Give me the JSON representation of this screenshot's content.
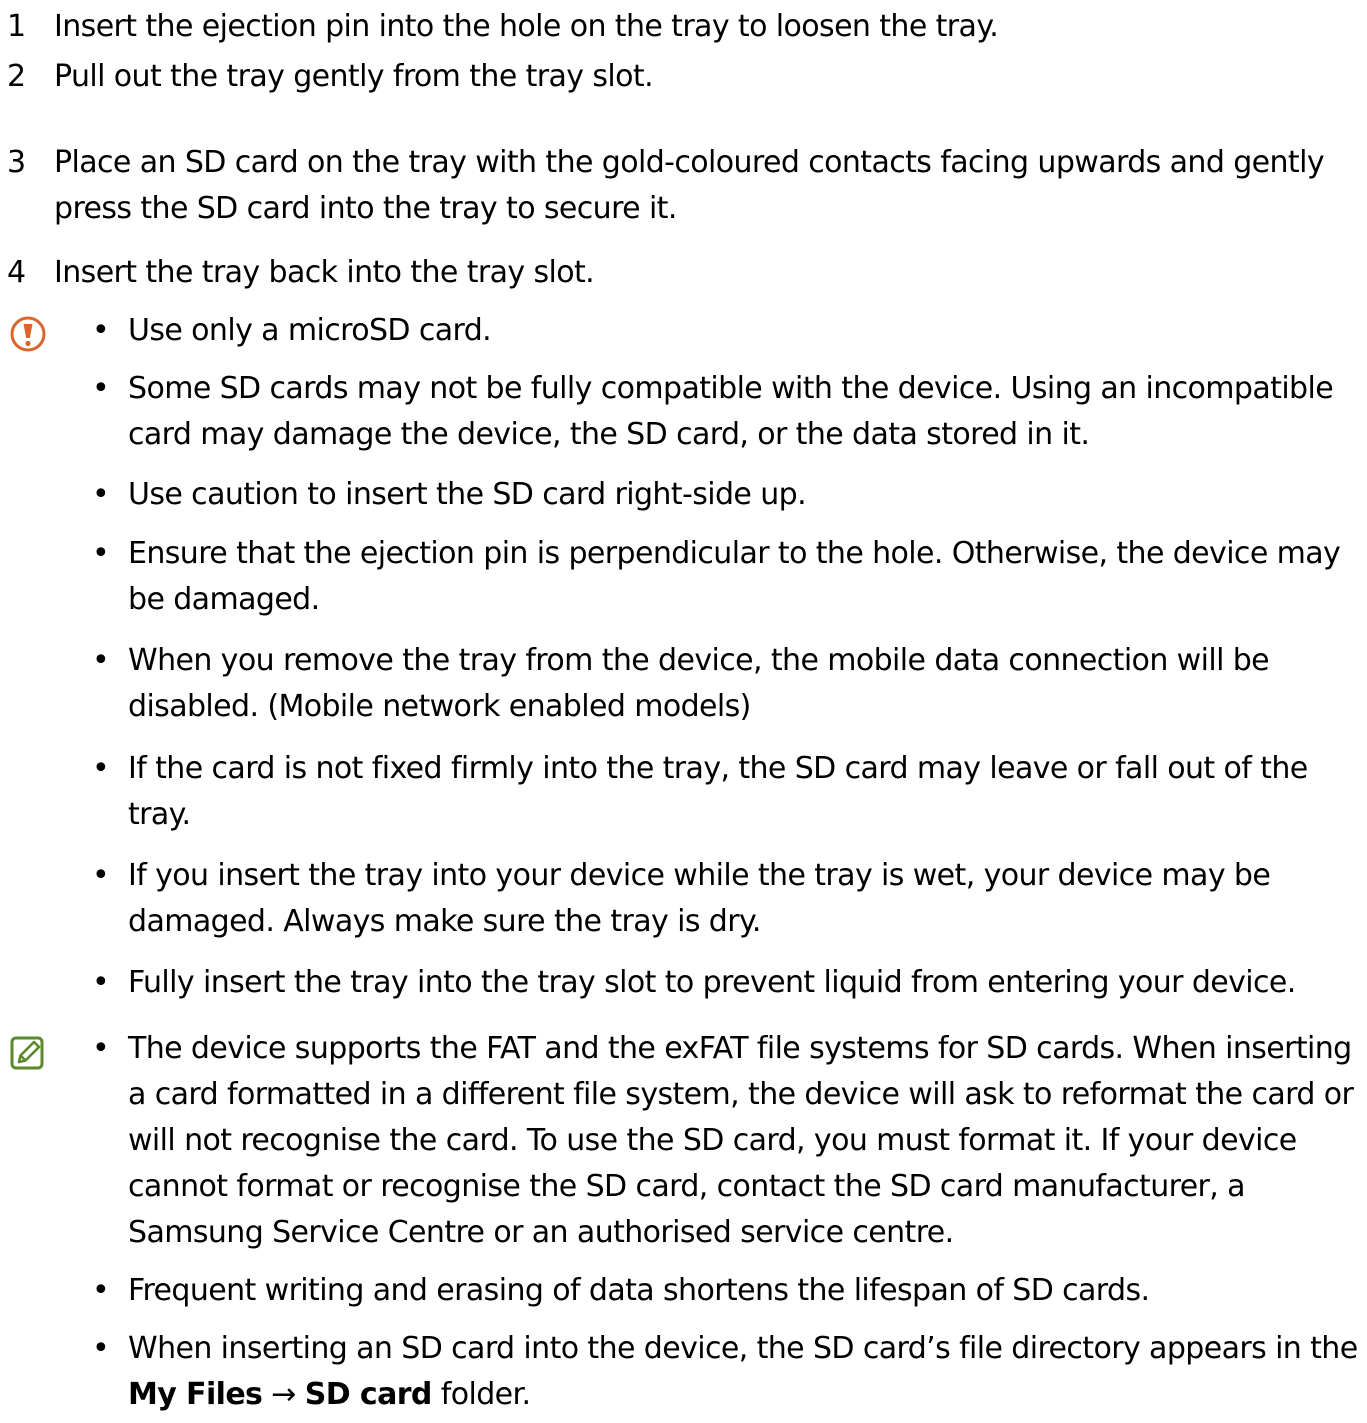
{
  "steps": [
    {
      "num": "1",
      "text": "Insert the ejection pin into the hole on the tray to loosen the tray."
    },
    {
      "num": "2",
      "text": "Pull out the tray gently from the tray slot."
    },
    {
      "num": "3",
      "text": "Place an SD card on the tray with the gold-coloured contacts facing upwards and gently press the SD card into the tray to secure it."
    },
    {
      "num": "4",
      "text": "Insert the tray back into the tray slot."
    }
  ],
  "caution": {
    "icon": "caution-exclamation-icon",
    "icon_color": "#d9642c",
    "bullet": "•",
    "items": [
      "Use only a microSD card.",
      "Some SD cards may not be fully compatible with the device. Using an incompatible card may damage the device, the SD card, or the data stored in it.",
      "Use caution to insert the SD card right-side up.",
      "Ensure that the ejection pin is perpendicular to the hole. Otherwise, the device may be damaged.",
      "When you remove the tray from the device, the mobile data connection will be disabled. (Mobile network enabled models)",
      "If the card is not fixed firmly into the tray, the SD card may leave or fall out of the tray.",
      "If you insert the tray into your device while the tray is wet, your device may be damaged. Always make sure the tray is dry.",
      "Fully insert the tray into the tray slot to prevent liquid from entering your device."
    ]
  },
  "note": {
    "icon": "note-pencil-icon",
    "icon_color": "#5a8a2b",
    "bullet": "•",
    "items": [
      "The device supports the FAT and the exFAT file systems for SD cards. When inserting a card formatted in a different file system, the device will ask to reformat the card or will not recognise the card. To use the SD card, you must format it. If your device cannot format or recognise the SD card, contact the SD card manufacturer, a Samsung Service Centre or an authorised service centre.",
      "Frequent writing and erasing of data shortens the lifespan of SD cards."
    ],
    "last_item": {
      "prefix": "When inserting an SD card into the device, the SD card’s file directory appears in the ",
      "menu_1": "My Files",
      "arrow": "→",
      "menu_2": "SD card",
      "suffix": " folder."
    }
  }
}
